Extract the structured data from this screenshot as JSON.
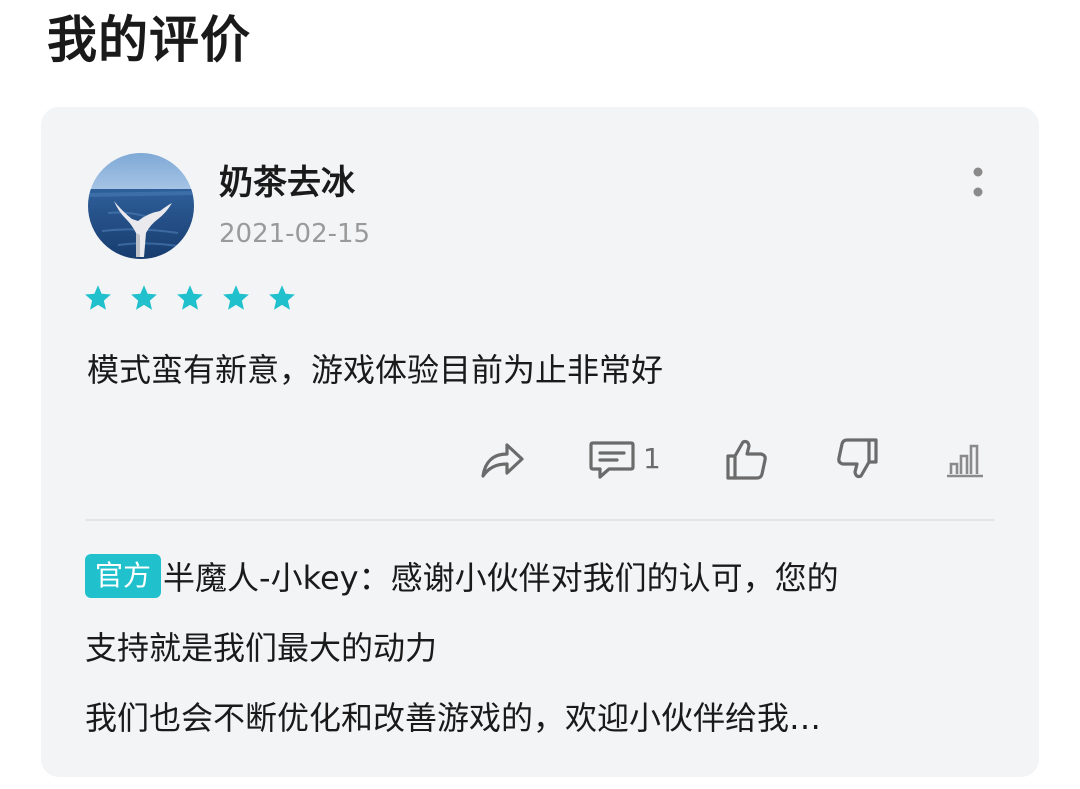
{
  "page": {
    "title": "我的评价"
  },
  "review": {
    "username": "奶茶去冰",
    "date": "2021-02-15",
    "rating": 5,
    "max_rating": 5,
    "star_color": "#20c1cc",
    "text": "模式蛮有新意，游戏体验目前为止非常好",
    "avatar_icon": "whale-tail-ocean-avatar",
    "more_icon": "more-vertical-icon"
  },
  "actions": {
    "share_icon": "share-icon",
    "comment_icon": "comment-icon",
    "comment_count": "1",
    "like_icon": "thumbs-up-icon",
    "dislike_icon": "thumbs-down-icon",
    "stats_icon": "bar-chart-icon"
  },
  "official_reply": {
    "badge": "官方",
    "badge_color": "#20c1cc",
    "line1": "半魔人-小key：感谢小伙伴对我们的认可，您的",
    "line2": "支持就是我们最大的动力",
    "line3": "我们也会不断优化和改善游戏的，欢迎小伙伴给我…"
  }
}
